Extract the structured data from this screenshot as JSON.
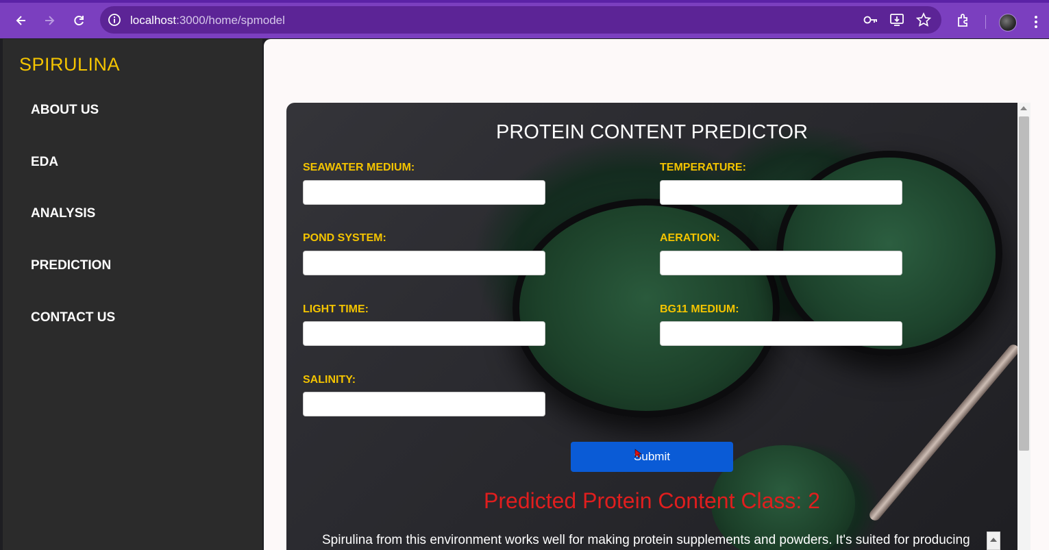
{
  "browser": {
    "url_host": "localhost",
    "url_path": ":3000/home/spmodel"
  },
  "sidebar": {
    "brand": "SPIRULINA",
    "items": [
      {
        "label": "ABOUT US"
      },
      {
        "label": "EDA"
      },
      {
        "label": "ANALYSIS"
      },
      {
        "label": "PREDICTION"
      },
      {
        "label": "CONTACT US"
      }
    ]
  },
  "form": {
    "title": "PROTEIN CONTENT PREDICTOR",
    "fields": {
      "seawater_medium": {
        "label": "SEAWATER MEDIUM:",
        "value": ""
      },
      "temperature": {
        "label": "TEMPERATURE:",
        "value": ""
      },
      "pond_system": {
        "label": "POND SYSTEM:",
        "value": ""
      },
      "aeration": {
        "label": "AERATION:",
        "value": ""
      },
      "light_time": {
        "label": "LIGHT TIME:",
        "value": ""
      },
      "bg11_medium": {
        "label": "BG11 MEDIUM:",
        "value": ""
      },
      "salinity": {
        "label": "SALINITY:",
        "value": ""
      }
    },
    "submit_label": "Submit",
    "result": "Predicted Protein Content Class: 2",
    "description": "Spirulina from this environment works well for making protein supplements and powders. It's suited for producing"
  },
  "colors": {
    "browser_chrome": "#7b3fbf",
    "sidebar_bg": "#2b2b2b",
    "brand": "#f4c400",
    "field_label": "#f4c400",
    "submit_bg": "#0a5bd6",
    "result_text": "#e01e1e"
  }
}
